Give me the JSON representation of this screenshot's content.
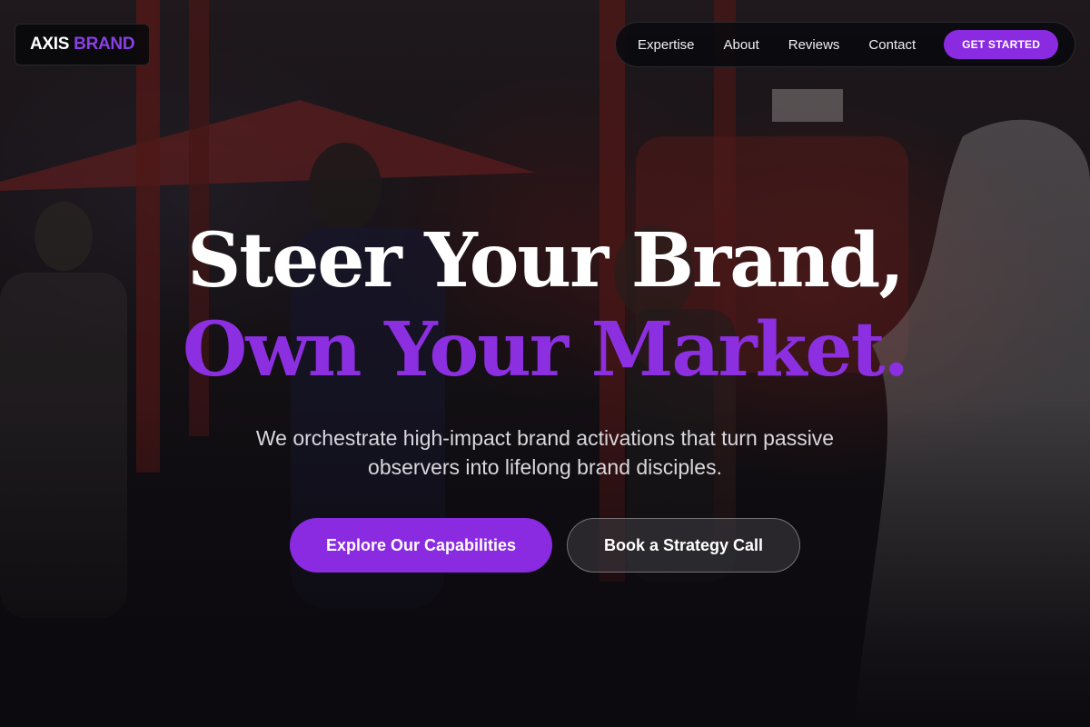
{
  "brand": {
    "name_part1": "AXIS",
    "name_part2": "BRAND",
    "accent_color": "#8a2be2"
  },
  "nav": {
    "links": [
      "Expertise",
      "About",
      "Reviews",
      "Contact"
    ],
    "cta_label": "GET STARTED"
  },
  "hero": {
    "headline_line1": "Steer Your Brand,",
    "headline_line2": "Own Your Market.",
    "subheadline": "We orchestrate high-impact brand activations that turn passive observers into lifelong brand disciples.",
    "primary_button": "Explore Our Capabilities",
    "secondary_button": "Book a Strategy Call"
  }
}
